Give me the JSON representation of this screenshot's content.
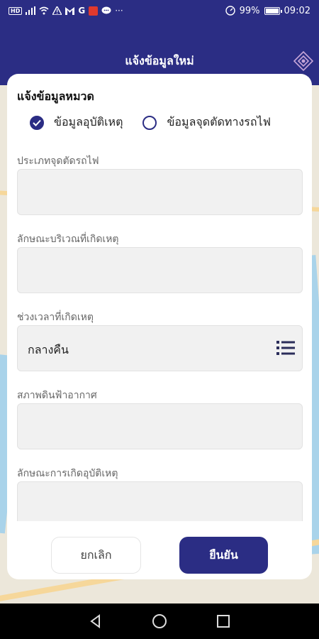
{
  "status_bar": {
    "battery": "99%",
    "time": "09:02",
    "left_icons": [
      "hd-icon",
      "signal-icon",
      "wifi-icon",
      "warning-icon",
      "mail-icon",
      "google-icon",
      "app-icon",
      "chat-icon",
      "more-icon"
    ]
  },
  "header": {
    "title": "แจ้งข้อมูลใหม่"
  },
  "card": {
    "title": "แจ้งข้อมูลหมวด",
    "radios": [
      {
        "label": "ข้อมูลอุบัติเหตุ",
        "checked": true
      },
      {
        "label": "ข้อมูลจุดตัดทางรถไฟ",
        "checked": false
      }
    ],
    "fields": [
      {
        "label": "ประเภทจุดตัดรถไฟ",
        "value": ""
      },
      {
        "label": "ลักษณะบริเวณที่เกิดเหตุ",
        "value": ""
      },
      {
        "label": "ช่วงเวลาที่เกิดเหตุ",
        "value": "กลางคืน"
      },
      {
        "label": "สภาพดินฟ้าอากาศ",
        "value": ""
      },
      {
        "label": "ลักษณะการเกิดอุบัติเหตุ",
        "value": ""
      }
    ],
    "cancel_label": "ยกเลิก",
    "confirm_label": "ยืนยัน"
  },
  "colors": {
    "primary": "#2b2d84",
    "field_bg": "#f1f1f1"
  }
}
